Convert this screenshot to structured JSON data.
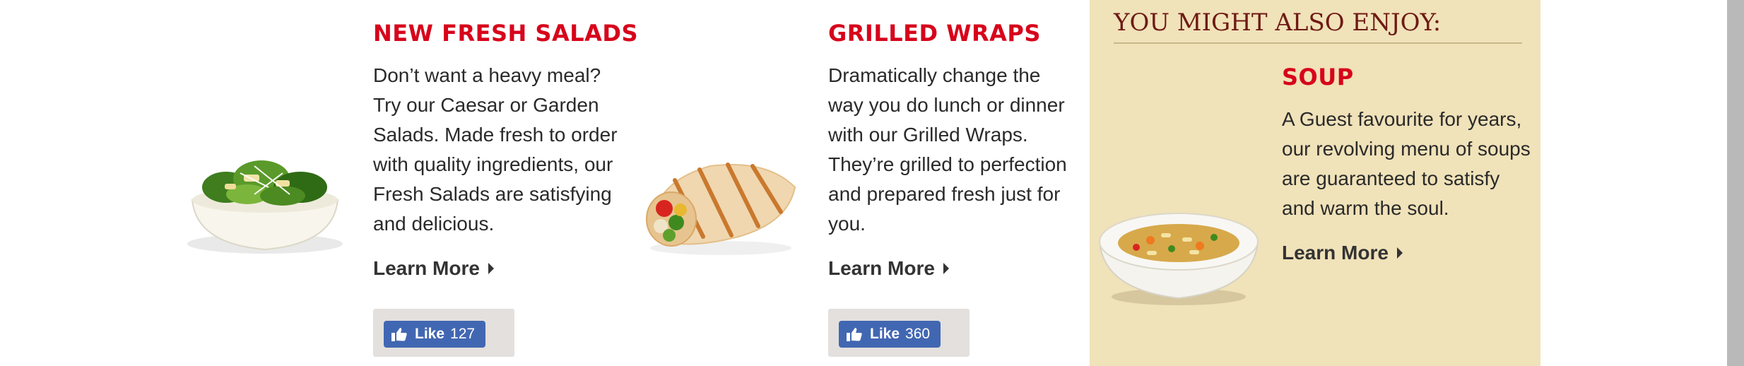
{
  "cards": [
    {
      "title": "NEW FRESH SALADS",
      "description": "Don’t want a heavy meal? Try our Caesar or Garden Salads. Made fresh to order with quality ingredients, our Fresh Salads are satisfying and delicious.",
      "learn_more": "Learn More",
      "like_label": "Like",
      "like_count": "127"
    },
    {
      "title": "GRILLED WRAPS",
      "description": "Dramatically change the way you do lunch or dinner with our Grilled Wraps. They’re grilled to perfection and prepared fresh just for you.",
      "learn_more": "Learn More",
      "like_label": "Like",
      "like_count": "360"
    }
  ],
  "aside": {
    "title": "YOU MIGHT ALSO ENJOY:",
    "item": {
      "title": "SOUP",
      "description": "A Guest favourite for years, our revolving menu of soups are guaranteed to satisfy and warm the soul.",
      "learn_more": "Learn More"
    }
  },
  "colors": {
    "heading_red": "#d7041b",
    "aside_bg": "#f0e2b9",
    "aside_title": "#6e1a14",
    "like_blue": "#4267b2"
  }
}
